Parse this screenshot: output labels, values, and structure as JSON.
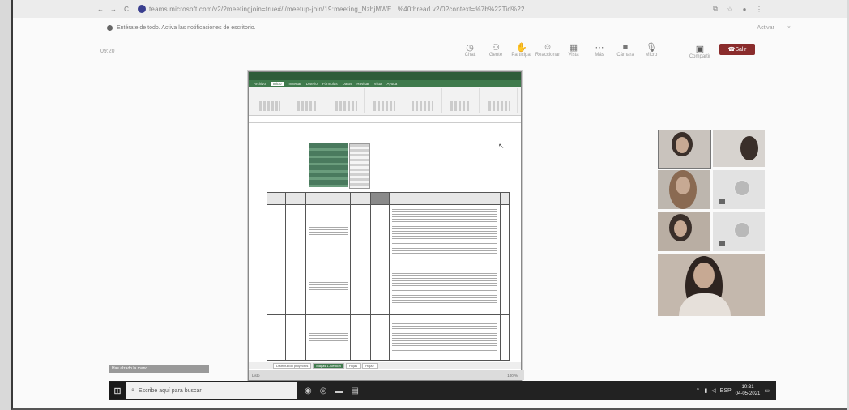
{
  "browser": {
    "url": "teams.microsoft.com/v2/?meetingjoin=true#/l/meetup-join/19:meeting_NzbjMWE...%40thread.v2/0?context=%7b%22Tid%22",
    "nav": [
      "←",
      "→",
      "C"
    ]
  },
  "notification": {
    "text": "Entérate de todo. Activa las notificaciones de escritorio.",
    "activate": "Activar",
    "close": "×"
  },
  "meeting": {
    "timer": "09:20",
    "tools": [
      {
        "icon": "◷",
        "label": "Chat"
      },
      {
        "icon": "⚇",
        "label": "Gente"
      },
      {
        "icon": "✋",
        "label": "Participar"
      },
      {
        "icon": "☺",
        "label": "Reaccionar"
      },
      {
        "icon": "▦",
        "label": "Vista"
      },
      {
        "icon": "⋯",
        "label": "Más"
      },
      {
        "icon": "■",
        "label": "Cámara"
      },
      {
        "icon": "🎙",
        "label": "Micro"
      }
    ],
    "share_label": "Compartir",
    "leave_label": "Salir"
  },
  "excel": {
    "tabs": [
      "Archivo",
      "Inicio",
      "Insertar",
      "Diseño",
      "Fórmulas",
      "Datos",
      "Revisar",
      "Vista",
      "Ayuda"
    ],
    "sheet_tabs": [
      "Distribución proyectos",
      "Mapas 1-Gestión",
      "Hoja1",
      "Hoja2"
    ],
    "status_left": "Listo",
    "status_right": "100 %"
  },
  "taskbar": {
    "raise_hand": "Has alzado la mano",
    "search_placeholder": "Escribe aquí para buscar",
    "tray_lang": "ESP",
    "time": "10:31",
    "date": "04-05-2021"
  }
}
